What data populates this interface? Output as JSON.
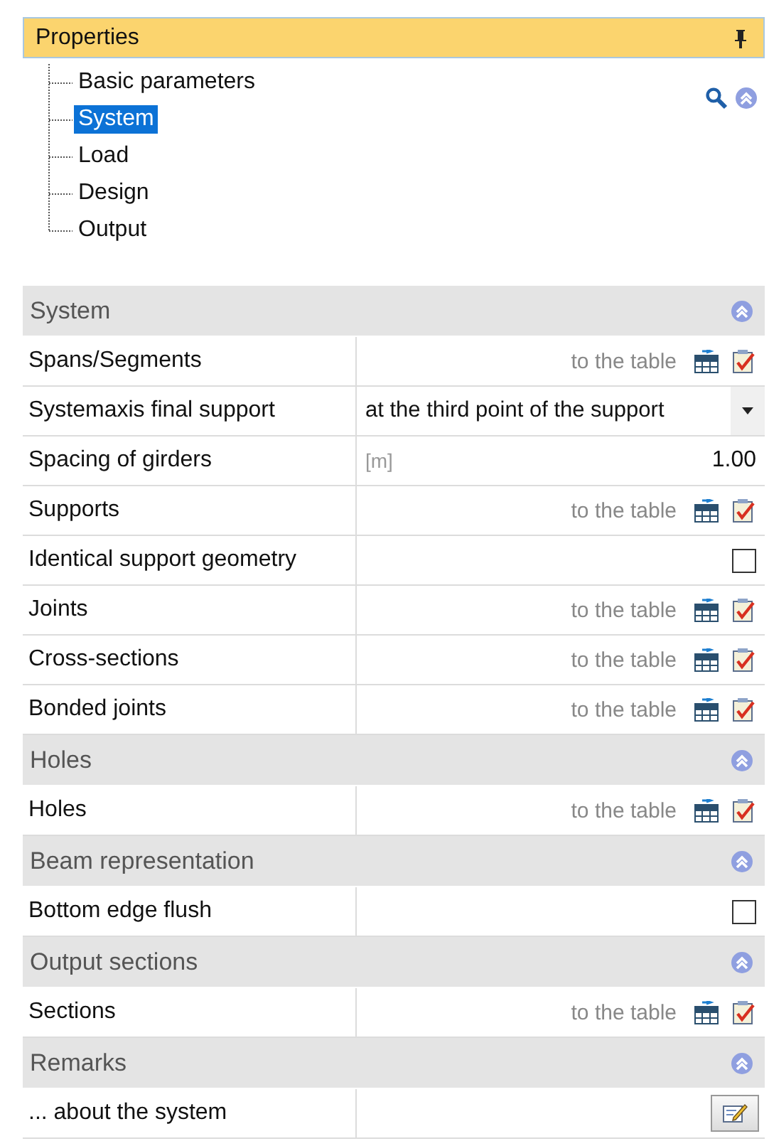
{
  "panel": {
    "title": "Properties"
  },
  "tree": [
    {
      "label": "Basic parameters",
      "selected": false
    },
    {
      "label": "System",
      "selected": true
    },
    {
      "label": "Load",
      "selected": false
    },
    {
      "label": "Design",
      "selected": false
    },
    {
      "label": "Output",
      "selected": false
    }
  ],
  "sections": [
    {
      "title": "System",
      "expanded": true,
      "rows": [
        {
          "label": "Spans/Segments",
          "kind": "table",
          "link": "to the table"
        },
        {
          "label": "Systemaxis final support",
          "kind": "dropdown",
          "value": "at the third point of the support"
        },
        {
          "label": "Spacing of girders",
          "kind": "number",
          "unit": "[m]",
          "value": "1.00"
        },
        {
          "label": "Supports",
          "kind": "table",
          "link": "to the table"
        },
        {
          "label": "Identical support geometry",
          "kind": "checkbox",
          "checked": false
        },
        {
          "label": "Joints",
          "kind": "table",
          "link": "to the table"
        },
        {
          "label": "Cross-sections",
          "kind": "table",
          "link": "to the table"
        },
        {
          "label": "Bonded joints",
          "kind": "table",
          "link": "to the table"
        }
      ]
    },
    {
      "title": "Holes",
      "expanded": true,
      "rows": [
        {
          "label": "Holes",
          "kind": "table",
          "link": "to the table"
        }
      ]
    },
    {
      "title": "Beam representation",
      "expanded": true,
      "rows": [
        {
          "label": "Bottom edge flush",
          "kind": "checkbox",
          "checked": false
        }
      ]
    },
    {
      "title": "Output sections",
      "expanded": true,
      "rows": [
        {
          "label": "Sections",
          "kind": "table",
          "link": "to the table"
        }
      ]
    },
    {
      "title": "Remarks",
      "expanded": true,
      "rows": [
        {
          "label": "... about the system",
          "kind": "edit"
        }
      ]
    }
  ]
}
